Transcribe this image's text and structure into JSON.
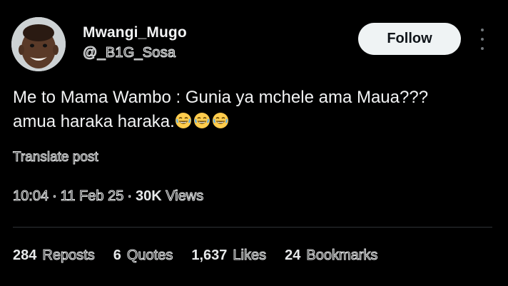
{
  "author": {
    "display_name": "Mwangi_Mugo",
    "handle": "@_B1G_Sosa"
  },
  "follow_label": "Follow",
  "tweet": {
    "text_line1": "Me to Mama Wambo : Gunia ya mchele ama Maua???",
    "text_line2": "amua haraka haraka.",
    "emoji_count": 3
  },
  "translate_label": "Translate post",
  "meta": {
    "time": "10:04",
    "date": "11 Feb 25",
    "views_count": "30K",
    "views_label": "Views"
  },
  "stats": [
    {
      "count": "284",
      "label": "Reposts"
    },
    {
      "count": "6",
      "label": "Quotes"
    },
    {
      "count": "1,637",
      "label": "Likes"
    },
    {
      "count": "24",
      "label": "Bookmarks"
    }
  ],
  "colors": {
    "background": "#000000",
    "text": "#e7e9ea",
    "follow_bg": "#eff3f4",
    "divider": "#2f3336",
    "muted_icon": "#71767b"
  }
}
